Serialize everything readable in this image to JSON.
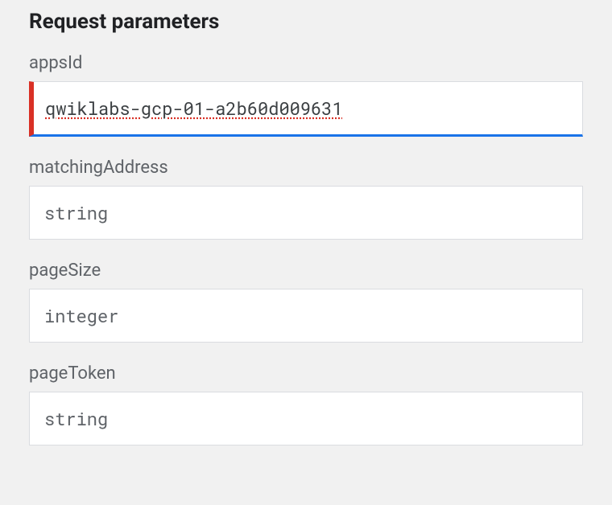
{
  "section": {
    "title": "Request parameters"
  },
  "params": {
    "appsId": {
      "label": "appsId",
      "value": "qwiklabs-gcp-01-a2b60d009631",
      "placeholder": ""
    },
    "matchingAddress": {
      "label": "matchingAddress",
      "value": "",
      "placeholder": "string"
    },
    "pageSize": {
      "label": "pageSize",
      "value": "",
      "placeholder": "integer"
    },
    "pageToken": {
      "label": "pageToken",
      "value": "",
      "placeholder": "string"
    }
  }
}
